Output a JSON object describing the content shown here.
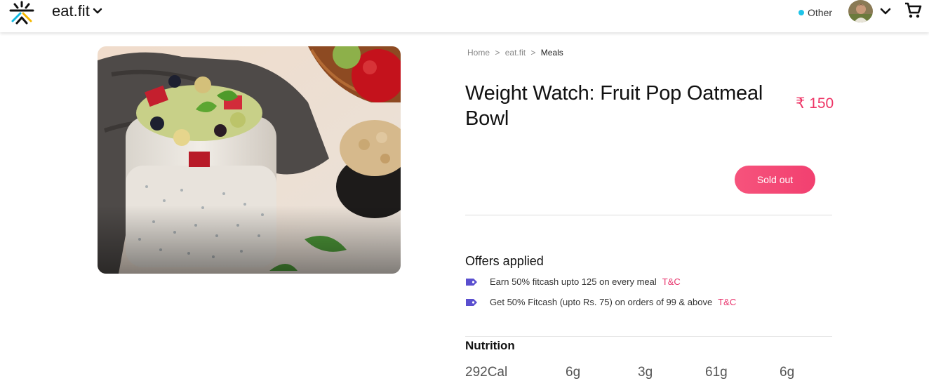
{
  "header": {
    "brand": "eat.fit",
    "location_label": "Other",
    "icons": {
      "logo": "cultfit-logo-icon",
      "brand_dropdown": "chevron-down-icon",
      "account_dropdown": "chevron-down-icon",
      "cart": "cart-icon"
    }
  },
  "breadcrumb": {
    "items": [
      "Home",
      "eat.fit",
      "Meals"
    ],
    "separator": ">"
  },
  "product": {
    "title": "Weight Watch: Fruit Pop Oatmeal Bowl",
    "price": "₹ 150",
    "status_button": "Sold out"
  },
  "offers": {
    "title": "Offers applied",
    "items": [
      {
        "text": "Earn 50% fitcash upto 125 on every meal",
        "link": "T&C"
      },
      {
        "text": "Get 50% Fitcash (upto Rs. 75) on orders of 99 & above",
        "link": "T&C"
      }
    ]
  },
  "nutrition": {
    "title": "Nutrition",
    "values": [
      "292Cal",
      "6g",
      "3g",
      "61g",
      "6g"
    ]
  },
  "colors": {
    "accent": "#ee3465",
    "location_dot": "#1fc4e8",
    "offer_tag": "#5a4fcf"
  }
}
